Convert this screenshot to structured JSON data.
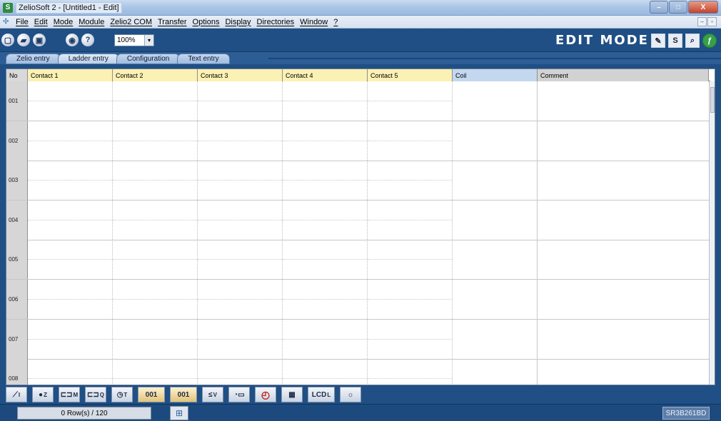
{
  "window": {
    "title": "ZelioSoft 2 - [Untitled1 - Edit]",
    "app_icon": "S",
    "controls": {
      "minimize": "–",
      "maximize": "□",
      "close": "X"
    }
  },
  "menu": {
    "items": [
      "File",
      "Edit",
      "Mode",
      "Module",
      "Zelio2 COM",
      "Transfer",
      "Options",
      "Display",
      "Directories",
      "Window",
      "?"
    ],
    "mdi_controls": {
      "minimize": "–",
      "restore": "▫"
    }
  },
  "toolbar": {
    "new_icon": "new-document-icon",
    "open_icon": "open-folder-icon",
    "save_icon": "save-disk-icon",
    "view_icon": "eye-icon",
    "help_label": "?",
    "zoom_value": "100%",
    "zoom_arrow": "▾",
    "mode_title": "EDIT MODE",
    "mode_icons": [
      {
        "name": "edit-mode-icon",
        "glyph": "✎"
      },
      {
        "name": "simulation-mode-icon",
        "glyph": "S"
      },
      {
        "name": "monitoring-mode-icon",
        "glyph": "⌕"
      },
      {
        "name": "zelio-logo-icon",
        "glyph": "ƒ"
      }
    ]
  },
  "tabs": [
    {
      "label": "Zelio entry",
      "active": false
    },
    {
      "label": "Ladder entry",
      "active": true
    },
    {
      "label": "Configuration",
      "active": false
    },
    {
      "label": "Text entry",
      "active": false
    }
  ],
  "grid": {
    "columns": {
      "no": "No",
      "contacts": [
        "Contact 1",
        "Contact 2",
        "Contact 3",
        "Contact 4",
        "Contact 5"
      ],
      "coil": "Coil",
      "comment": "Comment"
    },
    "rows": [
      "001",
      "002",
      "003",
      "004",
      "005",
      "006",
      "007",
      "008"
    ]
  },
  "palette": [
    {
      "name": "input-contact-icon",
      "glyph": "⟋",
      "sup": "I"
    },
    {
      "name": "zx-key-icon",
      "glyph": "●",
      "sup": "Z"
    },
    {
      "name": "auxiliary-relay-icon",
      "glyph": "⊏⊐",
      "sup": "M"
    },
    {
      "name": "output-coil-icon",
      "glyph": "⊏⊐",
      "sup": "Q"
    },
    {
      "name": "timer-icon",
      "glyph": "◷",
      "sup": "T"
    },
    {
      "name": "counter-icon",
      "glyph": "001",
      "sup": ""
    },
    {
      "name": "fast-counter-icon",
      "glyph": "001",
      "sup": ""
    },
    {
      "name": "analog-comparator-icon",
      "glyph": "≤",
      "sup": "V"
    },
    {
      "name": "analog-counter-comparator-icon",
      "glyph": "◔▭",
      "sup": ""
    },
    {
      "name": "clock-icon",
      "glyph": "◴",
      "sup": ""
    },
    {
      "name": "text-block-icon",
      "glyph": "▦",
      "sup": ""
    },
    {
      "name": "lcd-backlight-icon",
      "glyph": "LCD",
      "sup": "L"
    },
    {
      "name": "summer-winter-icon",
      "glyph": "☼",
      "sup": ""
    }
  ],
  "status": {
    "rows_label": "0 Row(s) / 120",
    "module_icon": "module-icon",
    "module_glyph": "⊞",
    "model": "SR3B261BD"
  },
  "colors": {
    "background": "#1f4f84",
    "contact_header": "#fbf1b4",
    "coil_header": "#c3d8ee",
    "comment_header": "#d2d2d2"
  }
}
